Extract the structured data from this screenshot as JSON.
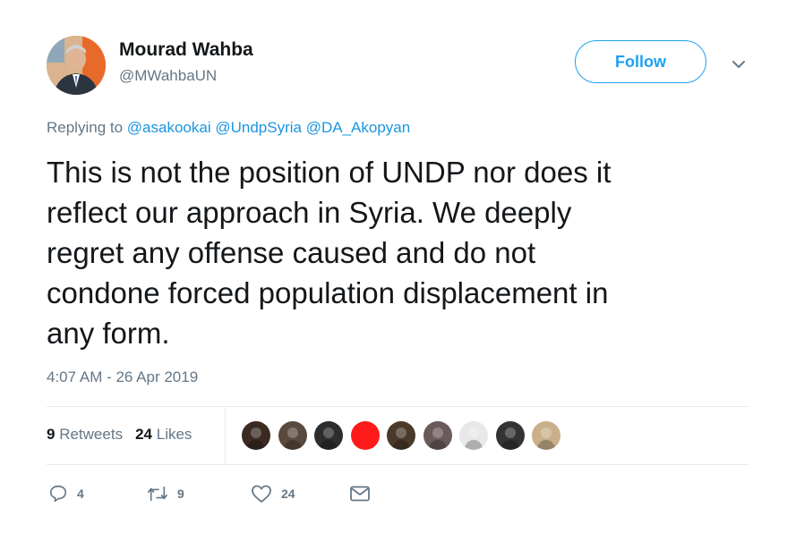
{
  "author": {
    "name": "Mourad Wahba",
    "handle": "@MWahbaUN",
    "avatar_icon": "profile-photo"
  },
  "follow_button": {
    "label": "Follow",
    "color": "#1da1f2"
  },
  "replying": {
    "prefix": "Replying to",
    "mentions": [
      "@asakookai",
      "@UndpSyria",
      "@DA_Akopyan"
    ],
    "mention_color": "#1b95e0"
  },
  "tweet": {
    "lines": [
      "This is not the position of UNDP nor does it",
      "reflect our approach in Syria. We deeply",
      "regret any offense caused and do not",
      "condone forced population displacement in",
      "any form."
    ]
  },
  "timestamp": "4:07 AM - 26 Apr 2019",
  "stats": {
    "retweets_count": "9",
    "retweets_label": "Retweets",
    "likes_count": "24",
    "likes_label": "Likes"
  },
  "liker_avatars": [
    "#3a2a22",
    "#5a4a3e",
    "#2d2d2d",
    "#ff1a1a",
    "#4a3a2a",
    "#6b5a5a",
    "#e8e8e8",
    "#333333",
    "#c9b08a"
  ],
  "actions": {
    "reply_count": "4",
    "retweet_count": "9",
    "like_count": "24",
    "dm_icon": "envelope-icon"
  }
}
